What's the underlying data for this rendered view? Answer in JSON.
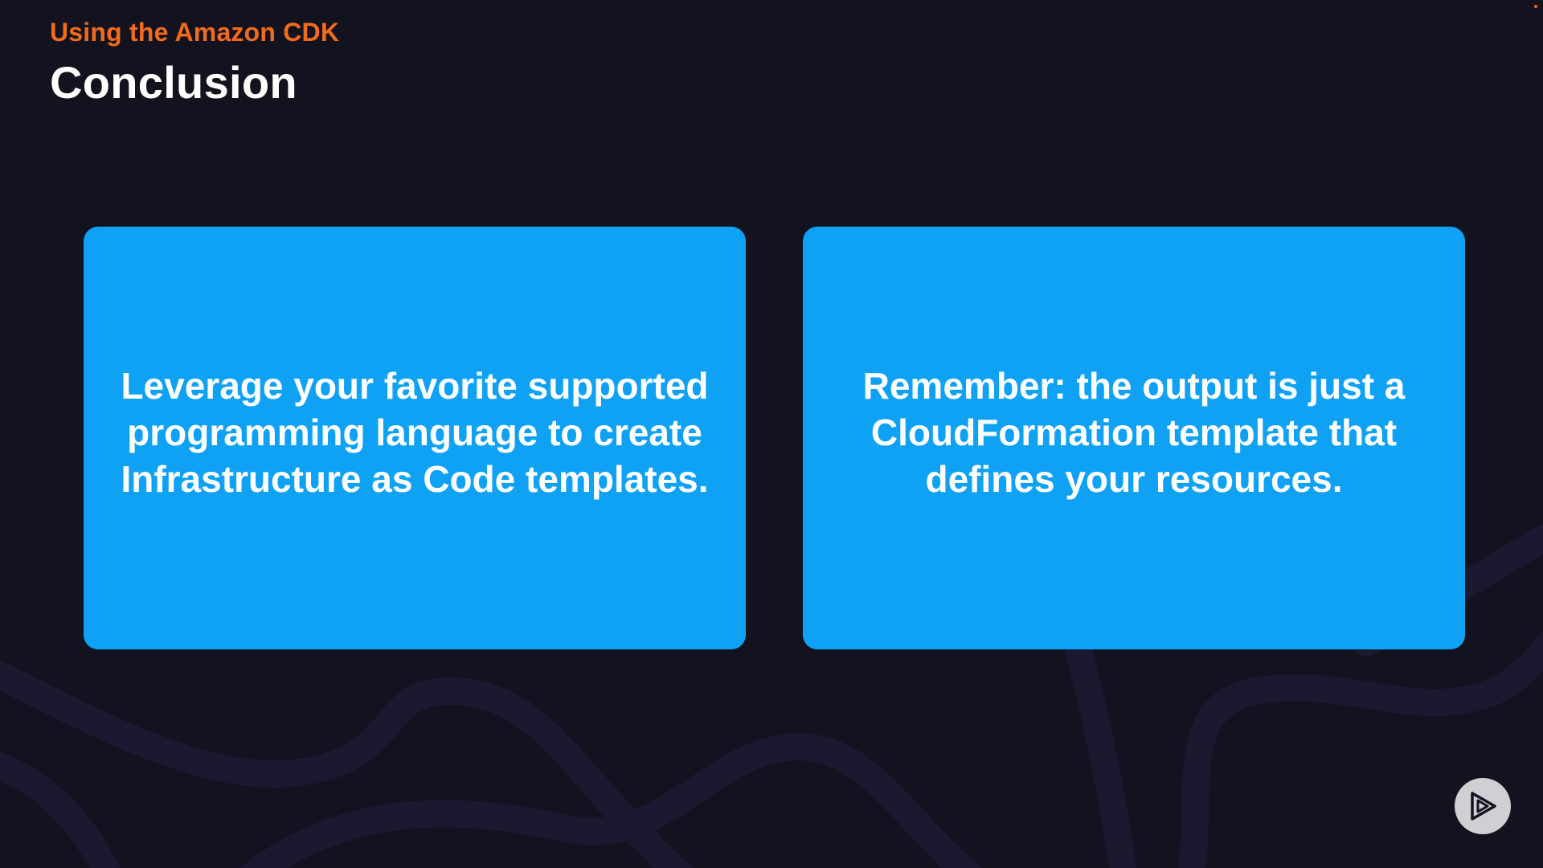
{
  "header": {
    "subtitle": "Using the Amazon CDK",
    "title": "Conclusion"
  },
  "cards": [
    {
      "text": "Leverage your favorite supported programming language to create Infrastructure as Code templates."
    },
    {
      "text": "Remember: the output is just a CloudFormation template that defines your resources."
    }
  ],
  "colors": {
    "background": "#13121f",
    "accent": "#f26b1d",
    "card": "#0fa2f4",
    "text": "#ffffff"
  },
  "icons": {
    "logo": "play-logo-icon"
  }
}
